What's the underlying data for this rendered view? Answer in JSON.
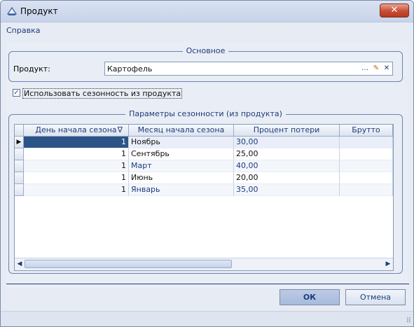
{
  "window": {
    "title": "Продукт",
    "close_glyph": "✕",
    "app_icon": "scale-icon"
  },
  "menu": {
    "items": [
      "Справка"
    ]
  },
  "main_group": {
    "title": "Основное",
    "product_label": "Продукт:",
    "product_value": "Картофель",
    "buttons": {
      "ellipsis": "…",
      "edit": "✎",
      "clear": "✕"
    }
  },
  "seasonality_checkbox": {
    "label": "Использовать сезонность из продукта",
    "checked": true
  },
  "params_group": {
    "title": "Параметры сезонности (из продукта)",
    "columns": [
      "День начала сезона",
      "Месяц начала сезона",
      "Процент потери",
      "Брутто"
    ],
    "sort_glyph": "∇",
    "rows": [
      {
        "day": "1",
        "month": "Ноябрь",
        "loss": "30,00",
        "brutto": ""
      },
      {
        "day": "1",
        "month": "Сентябрь",
        "loss": "25,00",
        "brutto": ""
      },
      {
        "day": "1",
        "month": "Март",
        "loss": "40,00",
        "brutto": ""
      },
      {
        "day": "1",
        "month": "Июнь",
        "loss": "20,00",
        "brutto": ""
      },
      {
        "day": "1",
        "month": "Январь",
        "loss": "35,00",
        "brutto": ""
      }
    ],
    "selected_row": 0,
    "current_row_marker": "▶"
  },
  "footer": {
    "ok_label": "ОК",
    "cancel_label": "Отмена"
  },
  "colors": {
    "selection": "#2d5486",
    "accent": "#1e3c7a",
    "close_button": "#c84d33"
  }
}
